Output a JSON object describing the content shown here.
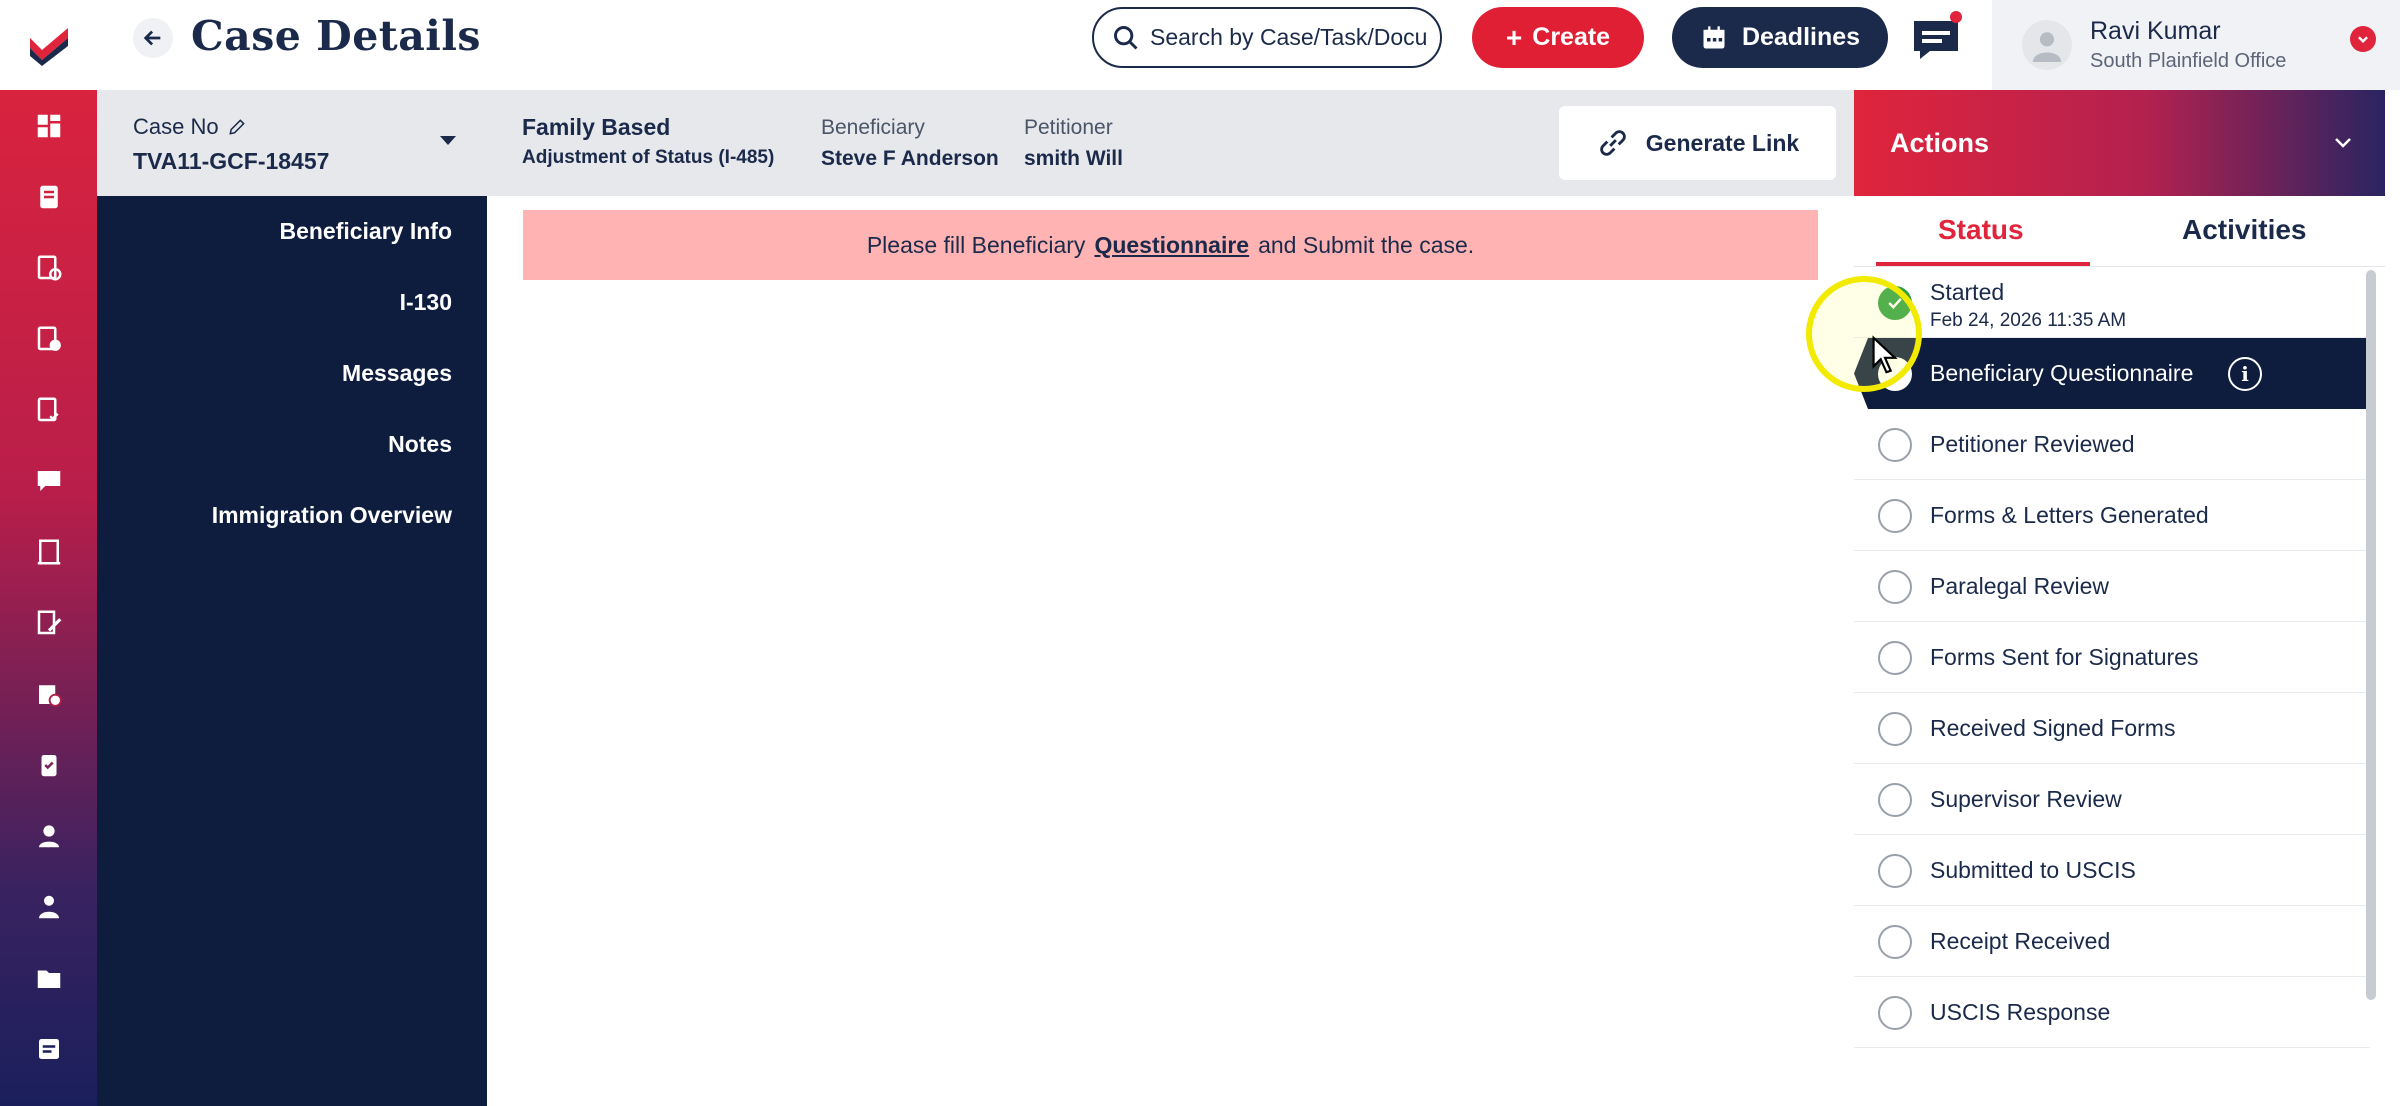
{
  "header": {
    "title": "Case Details",
    "search_placeholder": "Search by Case/Task/Docu",
    "create_label": "Create",
    "deadlines_label": "Deadlines",
    "user_name": "Ravi Kumar",
    "user_office": "South Plainfield Office"
  },
  "case": {
    "case_no_label": "Case No",
    "case_no": "TVA11-GCF-18457",
    "type": "Family Based",
    "subtype": "Adjustment of Status (I-485)",
    "beneficiary_label": "Beneficiary",
    "beneficiary": "Steve F Anderson",
    "petitioner_label": "Petitioner",
    "petitioner": "smith Will",
    "generate_link_label": "Generate Link"
  },
  "case_nav": [
    "Beneficiary Info",
    "I-130",
    "Messages",
    "Notes",
    "Immigration Overview"
  ],
  "alert": {
    "prefix": "Please fill Beneficiary",
    "link": "Questionnaire",
    "suffix": "and Submit the case."
  },
  "actions": {
    "title": "Actions",
    "tabs": [
      "Status",
      "Activities"
    ],
    "active_tab": "Status",
    "steps": [
      {
        "label": "Started",
        "date": "Feb 24, 2026 11:35 AM",
        "state": "done"
      },
      {
        "label": "Beneficiary Questionnaire",
        "state": "active"
      },
      {
        "label": "Petitioner Reviewed",
        "state": "pending"
      },
      {
        "label": "Forms & Letters Generated",
        "state": "pending"
      },
      {
        "label": "Paralegal Review",
        "state": "pending"
      },
      {
        "label": "Forms Sent for Signatures",
        "state": "pending"
      },
      {
        "label": "Received Signed Forms",
        "state": "pending"
      },
      {
        "label": "Supervisor Review",
        "state": "pending"
      },
      {
        "label": "Submitted to USCIS",
        "state": "pending"
      },
      {
        "label": "Receipt Received",
        "state": "pending"
      },
      {
        "label": "USCIS Response",
        "state": "pending"
      }
    ]
  },
  "rail_icons": [
    "dashboard-icon",
    "cases-icon",
    "documents-icon",
    "billing-icon",
    "tasks-icon",
    "chat-icon",
    "reports-icon",
    "forms-icon",
    "approvals-icon",
    "clipboard-icon",
    "person-icon",
    "team-icon",
    "folder-icon",
    "notes-icon"
  ],
  "colors": {
    "brand_red": "#e0243c",
    "navy": "#0e1c3e",
    "alert_bg": "#ffb3b3",
    "success": "#2f9e44"
  }
}
